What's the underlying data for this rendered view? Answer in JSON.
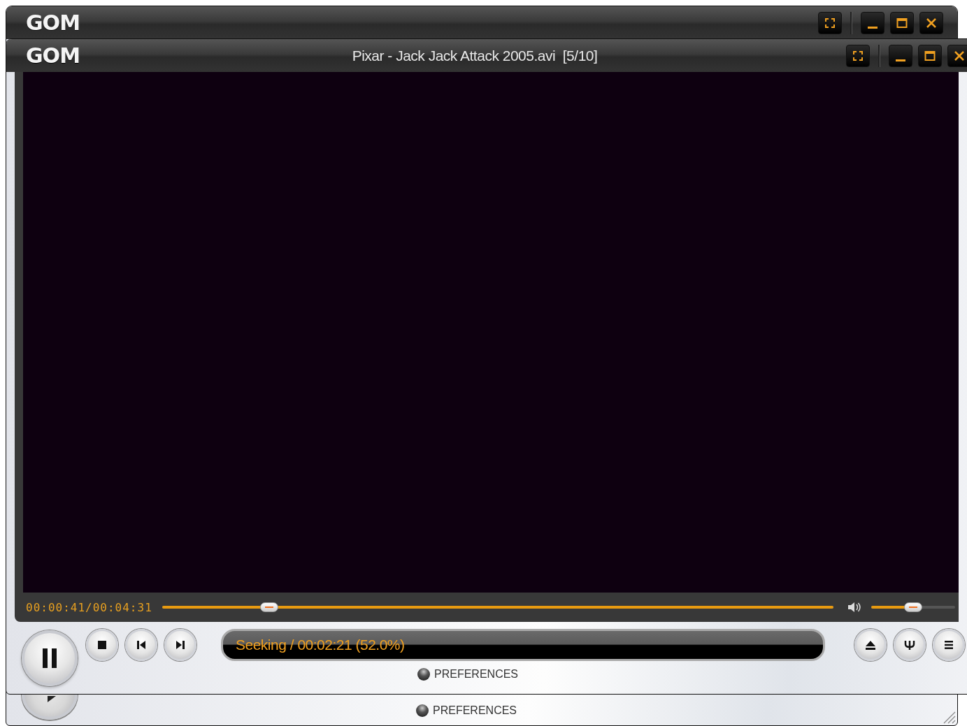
{
  "back_window": {
    "logo": "GOM",
    "preferences": "PREFERENCES"
  },
  "front_window": {
    "logo": "GOM",
    "title": "Pixar - Jack Jack Attack 2005.avi  [5/10]",
    "time": "00:00:41/00:04:31",
    "seek": {
      "level": 0.16
    },
    "volume": {
      "level": 0.5
    },
    "status": "Seeking / 00:02:21 (52.0%)",
    "preferences": "PREFERENCES"
  }
}
